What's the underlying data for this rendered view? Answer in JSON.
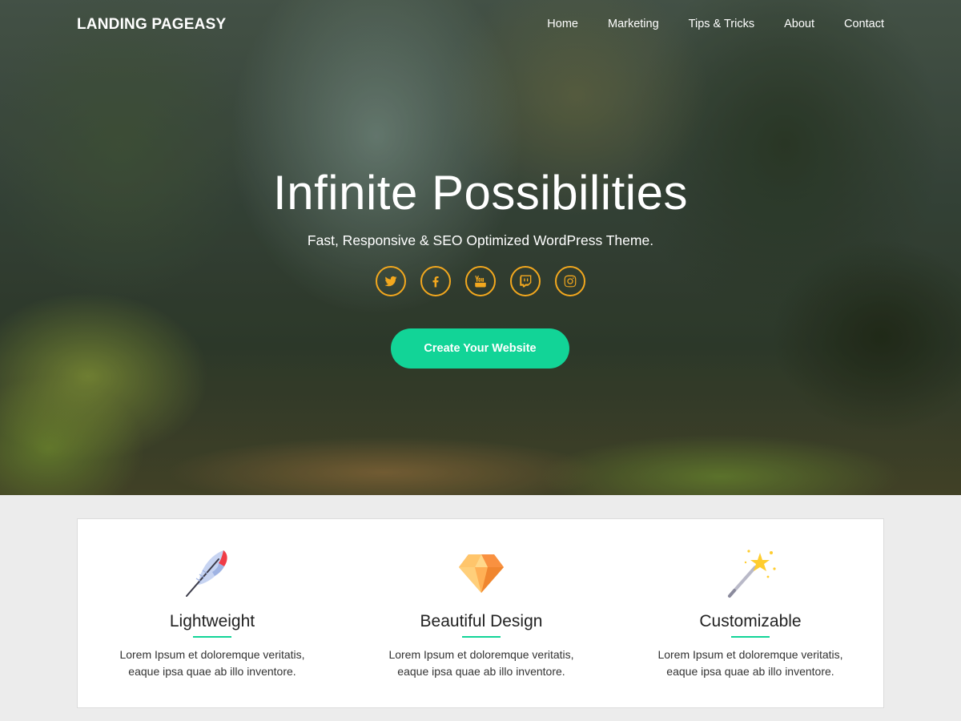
{
  "header": {
    "logo": "LANDING PAGEASY",
    "nav": [
      {
        "label": "Home"
      },
      {
        "label": "Marketing"
      },
      {
        "label": "Tips & Tricks"
      },
      {
        "label": "About"
      },
      {
        "label": "Contact"
      }
    ]
  },
  "hero": {
    "title": "Infinite Possibilities",
    "subtitle": "Fast, Responsive & SEO Optimized WordPress Theme.",
    "cta_label": "Create Your Website",
    "social": [
      {
        "icon": "twitter-icon"
      },
      {
        "icon": "facebook-icon"
      },
      {
        "icon": "youtube-icon"
      },
      {
        "icon": "twitch-icon"
      },
      {
        "icon": "instagram-icon"
      }
    ]
  },
  "features": [
    {
      "icon": "feather-icon",
      "title": "Lightweight",
      "line1": "Lorem Ipsum et doloremque veritatis,",
      "line2": "eaque ipsa quae ab illo inventore."
    },
    {
      "icon": "diamond-icon",
      "title": "Beautiful Design",
      "line1": "Lorem Ipsum et doloremque veritatis,",
      "line2": "eaque ipsa quae ab illo inventore."
    },
    {
      "icon": "magic-wand-icon",
      "title": "Customizable",
      "line1": "Lorem Ipsum et doloremque veritatis,",
      "line2": "eaque ipsa quae ab illo inventore."
    }
  ],
  "colors": {
    "accent": "#12d497",
    "social_icon": "#f3a81e",
    "page_background": "#ececec"
  }
}
